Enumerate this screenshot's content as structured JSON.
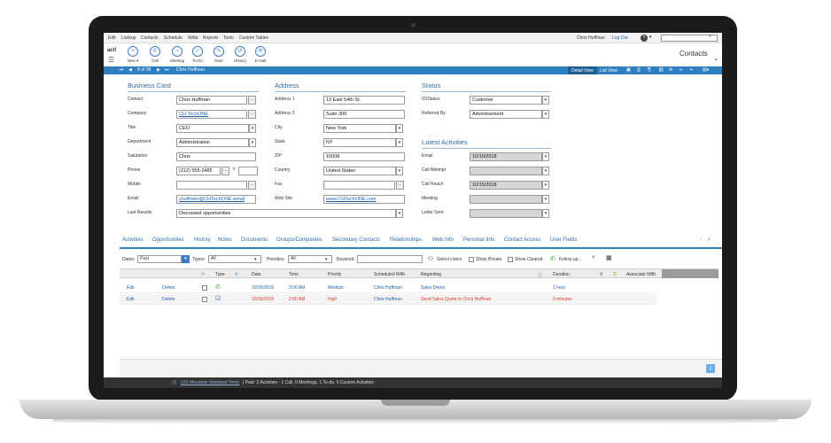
{
  "menu": [
    "Edit",
    "Lookup",
    "Contacts",
    "Schedule",
    "Write",
    "Reports",
    "Tools",
    "Custom Tables"
  ],
  "header": {
    "user": "Chris Huffman",
    "logout": "Log Out",
    "help_icon": "question-icon"
  },
  "toolbar": {
    "logo": "act!",
    "buttons": [
      {
        "label": "New ▾",
        "icon": "new-contact-icon"
      },
      {
        "label": "Call",
        "icon": "phone-icon"
      },
      {
        "label": "Meeting",
        "icon": "meeting-icon"
      },
      {
        "label": "To-Do",
        "icon": "todo-icon"
      },
      {
        "label": "Note",
        "icon": "note-icon"
      },
      {
        "label": "History",
        "icon": "history-icon"
      },
      {
        "label": "E-mail",
        "icon": "email-icon"
      }
    ],
    "title": "Contacts"
  },
  "nav": {
    "count": "8 of 28",
    "contact": "Chris Huffman",
    "detail_view": "Detail View",
    "list_view": "List View"
  },
  "business_card": {
    "title": "Business Card",
    "contact_label": "Contact",
    "contact": "Chris Huffman",
    "company_label": "Company",
    "company": "CH.TechONE",
    "title_label": "Title",
    "title_value": "CEO",
    "department_label": "Department",
    "department": "Administration",
    "salutation_label": "Salutation",
    "salutation": "Chris",
    "phone_label": "Phone",
    "phone": "(212) 555-2485",
    "ext_label": "x",
    "mobile_label": "Mobile",
    "mobile": "",
    "email_label": "Email",
    "email": "chuffman@CHTechONE.email",
    "last_results_label": "Last Results",
    "last_results": "Discussed opportunities"
  },
  "address": {
    "title": "Address",
    "address1_label": "Address 1",
    "address1": "13 East 54th St.",
    "address2_label": "Address 2",
    "address2": "Suite 300",
    "city_label": "City",
    "city": "New York",
    "state_label": "State",
    "state": "NY",
    "zip_label": "ZIP",
    "zip": "10008",
    "country_label": "Country",
    "country": "United States",
    "fax_label": "Fax",
    "fax": "",
    "website_label": "Web Site",
    "website": "www.CHTechONE.com"
  },
  "status": {
    "title": "Status",
    "id_status_label": "ID/Status",
    "id_status": "Customer",
    "referred_by_label": "Referred By",
    "referred_by": "Advertisement"
  },
  "latest": {
    "title": "Latest Activities",
    "email_label": "Email",
    "email": "10/16/2018",
    "call_attempt_label": "Call Attempt",
    "call_attempt": "",
    "call_reach_label": "Call Reach",
    "call_reach": "10/15/2018",
    "meeting_label": "Meeting",
    "meeting": "",
    "letter_sent_label": "Letter Sent",
    "letter_sent": ""
  },
  "tabs": [
    "Activities",
    "Opportunities",
    "History",
    "Notes",
    "Documents",
    "Groups/Companies",
    "Secondary Contacts",
    "Relationships",
    "Web Info",
    "Personal Info",
    "Contact Access",
    "User Fields"
  ],
  "filters": {
    "dates_label": "Dates:",
    "dates": "Past",
    "types_label": "Types:",
    "types": "All",
    "priorities_label": "Priorities:",
    "priorities": "All",
    "keyword_label": "Keyword:",
    "keyword": "",
    "select_users": "Select Users",
    "show_private": "Show Private",
    "show_cleared": "Show Cleared",
    "follow_up": "Follow up..."
  },
  "grid": {
    "headers": [
      "Type",
      "Date",
      "Time",
      "Priority",
      "Scheduled With",
      "Regarding",
      "Duration",
      "Associate With"
    ],
    "rows": [
      {
        "edit": "Edit",
        "delete": "Delete",
        "type_icon": "phone-icon",
        "date": "10/15/2018",
        "time": "3:00 AM",
        "priority": "Medium",
        "scheduled_with": "Chris Huffman",
        "regarding": "Sales Demo",
        "duration": "1 hour",
        "color": "#1f5fa8"
      },
      {
        "edit": "Edit",
        "delete": "Delete",
        "type_icon": "todo-check-icon",
        "date": "10/16/2018",
        "time": "2:00 AM",
        "priority": "High",
        "scheduled_with": "Chris Huffman",
        "regarding": "Send Sales Quote to Chris Huffman",
        "duration": "5 minutes",
        "color": "#d93a2b"
      }
    ],
    "page": "1"
  },
  "statusbar": {
    "timezone": "(US Mountain Standard Time)",
    "summary": "| Past: 2 Activities - 1 Call, 0 Meetings, 1 To-do, 0 Custom Activities"
  }
}
